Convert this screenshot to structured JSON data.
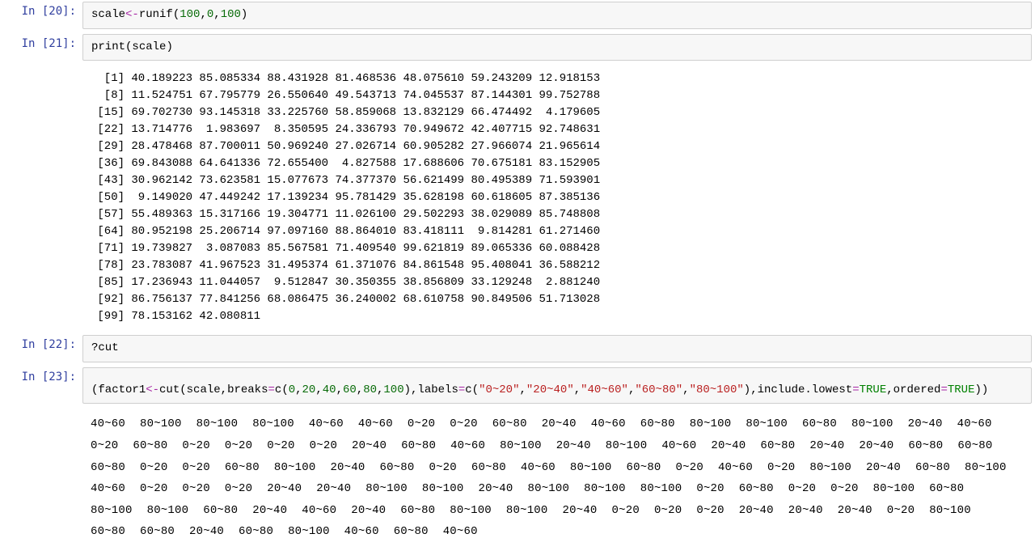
{
  "cells": {
    "c20": {
      "prompt": "In [20]:",
      "code_tokens": [
        {
          "t": "scale",
          "c": "kw"
        },
        {
          "t": "<-",
          "c": "op"
        },
        {
          "t": "runif",
          "c": "fn"
        },
        {
          "t": "(",
          "c": "paren"
        },
        {
          "t": "100",
          "c": "num"
        },
        {
          "t": ",",
          "c": "paren"
        },
        {
          "t": "0",
          "c": "num"
        },
        {
          "t": ",",
          "c": "paren"
        },
        {
          "t": "100",
          "c": "num"
        },
        {
          "t": ")",
          "c": "paren"
        }
      ]
    },
    "c21": {
      "prompt": "In [21]:",
      "code_tokens": [
        {
          "t": "print",
          "c": "fn"
        },
        {
          "t": "(",
          "c": "paren"
        },
        {
          "t": "scale",
          "c": "kw"
        },
        {
          "t": ")",
          "c": "paren"
        }
      ],
      "output": "  [1] 40.189223 85.085334 88.431928 81.468536 48.075610 59.243209 12.918153\n  [8] 11.524751 67.795779 26.550640 49.543713 74.045537 87.144301 99.752788\n [15] 69.702730 93.145318 33.225760 58.859068 13.832129 66.474492  4.179605\n [22] 13.714776  1.983697  8.350595 24.336793 70.949672 42.407715 92.748631\n [29] 28.478468 87.700011 50.969240 27.026714 60.905282 27.966074 21.965614\n [36] 69.843088 64.641336 72.655400  4.827588 17.688606 70.675181 83.152905\n [43] 30.962142 73.623581 15.077673 74.377370 56.621499 80.495389 71.593901\n [50]  9.149020 47.449242 17.139234 95.781429 35.628198 60.618605 87.385136\n [57] 55.489363 15.317166 19.304771 11.026100 29.502293 38.029089 85.748808\n [64] 80.952198 25.206714 97.097160 88.864010 83.418111  9.814281 61.271460\n [71] 19.739827  3.087083 85.567581 71.409540 99.621819 89.065336 60.088428\n [78] 23.783087 41.967523 31.495374 61.371076 84.861548 95.408041 36.588212\n [85] 17.236943 11.044057  9.512847 30.350355 38.856809 33.129248  2.881240\n [92] 86.756137 77.841256 68.086475 36.240002 68.610758 90.849506 51.713028\n [99] 78.153162 42.080811"
    },
    "c22": {
      "prompt": "In [22]:",
      "code_tokens": [
        {
          "t": "?cut",
          "c": "kw"
        }
      ]
    },
    "c23": {
      "prompt": "In [23]:",
      "code_tokens": [
        {
          "t": "(",
          "c": "paren"
        },
        {
          "t": "factor1",
          "c": "kw"
        },
        {
          "t": "<-",
          "c": "op"
        },
        {
          "t": "cut",
          "c": "fn"
        },
        {
          "t": "(",
          "c": "paren"
        },
        {
          "t": "scale",
          "c": "kw"
        },
        {
          "t": ",",
          "c": "paren"
        },
        {
          "t": "breaks",
          "c": "kw"
        },
        {
          "t": "=",
          "c": "op"
        },
        {
          "t": "c",
          "c": "fn"
        },
        {
          "t": "(",
          "c": "paren"
        },
        {
          "t": "0",
          "c": "num"
        },
        {
          "t": ",",
          "c": "paren"
        },
        {
          "t": "20",
          "c": "num"
        },
        {
          "t": ",",
          "c": "paren"
        },
        {
          "t": "40",
          "c": "num"
        },
        {
          "t": ",",
          "c": "paren"
        },
        {
          "t": "60",
          "c": "num"
        },
        {
          "t": ",",
          "c": "paren"
        },
        {
          "t": "80",
          "c": "num"
        },
        {
          "t": ",",
          "c": "paren"
        },
        {
          "t": "100",
          "c": "num"
        },
        {
          "t": ")",
          "c": "paren"
        },
        {
          "t": ",",
          "c": "paren"
        },
        {
          "t": "labels",
          "c": "kw"
        },
        {
          "t": "=",
          "c": "op"
        },
        {
          "t": "c",
          "c": "fn"
        },
        {
          "t": "(",
          "c": "paren"
        },
        {
          "t": "\"0~20\"",
          "c": "str"
        },
        {
          "t": ",",
          "c": "paren"
        },
        {
          "t": "\"20~40\"",
          "c": "str"
        },
        {
          "t": ",",
          "c": "paren"
        },
        {
          "t": "\"40~60\"",
          "c": "str"
        },
        {
          "t": ",",
          "c": "paren"
        },
        {
          "t": "\"60~80\"",
          "c": "str"
        },
        {
          "t": ",",
          "c": "paren"
        },
        {
          "t": "\"80~100\"",
          "c": "str"
        },
        {
          "t": ")",
          "c": "paren"
        },
        {
          "t": ",",
          "c": "paren"
        },
        {
          "t": "include.lowest",
          "c": "kw"
        },
        {
          "t": "=",
          "c": "op"
        },
        {
          "t": "TRUE",
          "c": "bool"
        },
        {
          "t": ",",
          "c": "paren"
        },
        {
          "t": "ordered",
          "c": "kw"
        },
        {
          "t": "=",
          "c": "op"
        },
        {
          "t": "TRUE",
          "c": "bool"
        },
        {
          "t": ")",
          "c": "paren"
        },
        {
          "t": ")",
          "c": "paren"
        }
      ],
      "output_levels": [
        "40~60",
        "80~100",
        "80~100",
        "80~100",
        "40~60",
        "40~60",
        "0~20",
        "0~20",
        "60~80",
        "20~40",
        "40~60",
        "60~80",
        "80~100",
        "80~100",
        "60~80",
        "80~100",
        "20~40",
        "40~60",
        "0~20",
        "60~80",
        "0~20",
        "0~20",
        "0~20",
        "0~20",
        "20~40",
        "60~80",
        "40~60",
        "80~100",
        "20~40",
        "80~100",
        "40~60",
        "20~40",
        "60~80",
        "20~40",
        "20~40",
        "60~80",
        "60~80",
        "60~80",
        "0~20",
        "0~20",
        "60~80",
        "80~100",
        "20~40",
        "60~80",
        "0~20",
        "60~80",
        "40~60",
        "80~100",
        "60~80",
        "0~20",
        "40~60",
        "0~20",
        "80~100",
        "20~40",
        "60~80",
        "80~100",
        "40~60",
        "0~20",
        "0~20",
        "0~20",
        "20~40",
        "20~40",
        "80~100",
        "80~100",
        "20~40",
        "80~100",
        "80~100",
        "80~100",
        "0~20",
        "60~80",
        "0~20",
        "0~20",
        "80~100",
        "60~80",
        "80~100",
        "80~100",
        "60~80",
        "20~40",
        "40~60",
        "20~40",
        "60~80",
        "80~100",
        "80~100",
        "20~40",
        "0~20",
        "0~20",
        "0~20",
        "20~40",
        "20~40",
        "20~40",
        "0~20",
        "80~100",
        "60~80",
        "60~80",
        "20~40",
        "60~80",
        "80~100",
        "40~60",
        "60~80",
        "40~60"
      ]
    }
  }
}
